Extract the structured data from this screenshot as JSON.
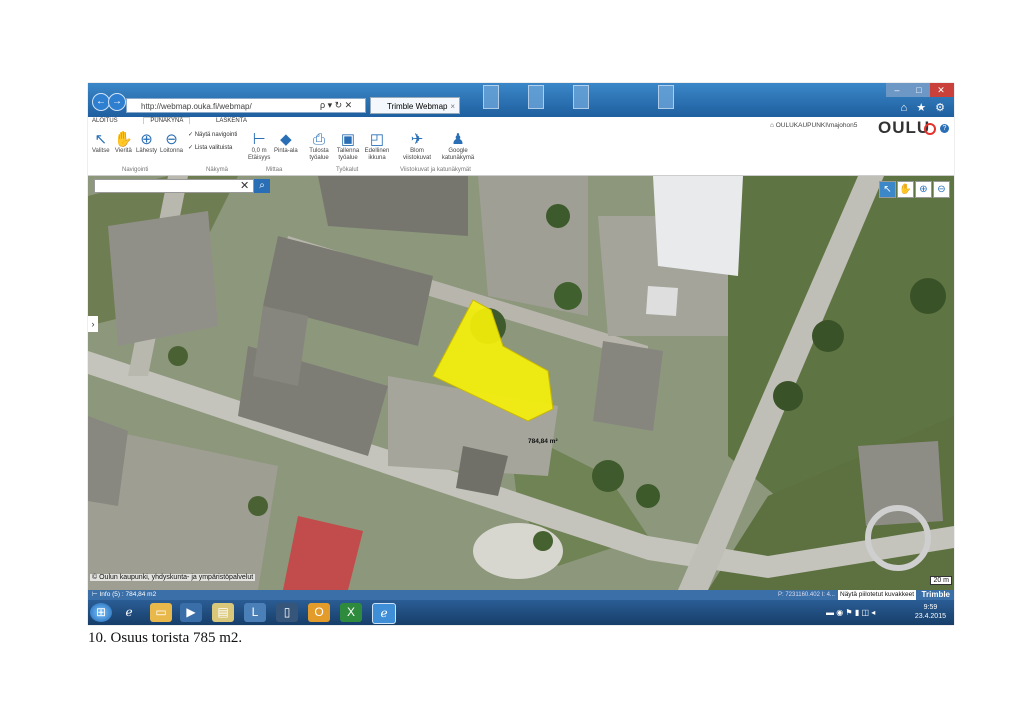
{
  "browser": {
    "url": "http://webmap.ouka.fi/webmap/",
    "url_controls": "ρ ▾ ↻ ✕",
    "tab_title": "Trimble Webmap",
    "tab_close": "×",
    "back_icon": "←",
    "forward_icon": "→",
    "top_icons": "⌂ ★ ⚙"
  },
  "ribbon": {
    "tabs": [
      "ALOITUS",
      "PUNAKYNÄ",
      "LASKENTA"
    ],
    "tools": {
      "valitse": "Valitse",
      "vierita": "Vieritä",
      "lahesty": "Lähesty",
      "loitonna": "Loitonna",
      "etaisyys": "Etäisyys",
      "pinta_ala": "Pinta-ala",
      "tulosta": "Tulosta työalue",
      "tallenna": "Tallenna työalue",
      "edellinen": "Edellinen ikkuna",
      "blom": "Blom viistokuvat",
      "google": "Google katunäkymä"
    },
    "checkboxes": [
      "Näytä navigointi",
      "Lista valituista"
    ],
    "measure_readout": "0,0 m",
    "groups": [
      "Navigointi",
      "Näkymä",
      "Mittaa",
      "Työkalut",
      "Viistokuvat ja katunäkymät"
    ],
    "account": "OULUKAUPUNKI\\majohon5",
    "logo": "OULU",
    "help": "?"
  },
  "map": {
    "search_placeholder": "",
    "search_clear": "✕",
    "search_button": "⌕",
    "side_toggle": "›",
    "measurement_label": "784,84 m²",
    "copyright": "© Oulun kaupunki, yhdyskunta- ja ympäristöpalvelut",
    "scale": "20 m",
    "highlight_color": "#f5f00a"
  },
  "status": {
    "info": "Info (5) : 784,84 m2",
    "coords": "P: 7231160.402 I: 4...",
    "image_button": "Näytä piilotetut kuvakkeet",
    "brand": "Trimble"
  },
  "taskbar": {
    "time": "9:59",
    "date": "23.4.2015"
  },
  "caption": "10. Osuus torista 785 m2."
}
